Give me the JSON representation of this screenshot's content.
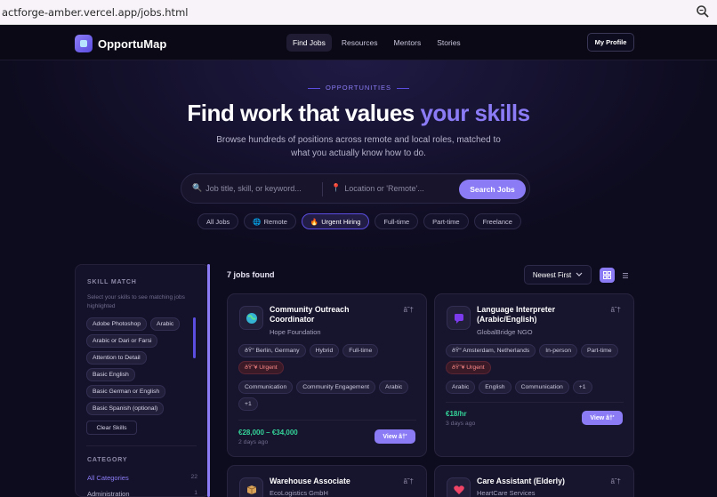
{
  "browser": {
    "url": "actforge-amber.vercel.app/jobs.html"
  },
  "nav": {
    "brand": "OpportuMap",
    "links": [
      "Find Jobs",
      "Resources",
      "Mentors",
      "Stories"
    ],
    "profile": "My Profile"
  },
  "hero": {
    "eyebrow": "OPPORTUNITIES",
    "title_main": "Find work that values ",
    "title_accent": "your skills",
    "subtitle": "Browse hundreds of positions across remote and local roles, matched to what you actually know how to do.",
    "search_icon": "🔍",
    "search_placeholder": "Job title, skill, or keyword...",
    "location_icon": "📍",
    "location_placeholder": "Location or 'Remote'...",
    "search_button": "Search Jobs"
  },
  "filters": [
    {
      "icon": "",
      "label": "All Jobs"
    },
    {
      "icon": "🌐",
      "label": "Remote"
    },
    {
      "icon": "🔥",
      "label": "Urgent Hiring"
    },
    {
      "icon": "",
      "label": "Full-time"
    },
    {
      "icon": "",
      "label": "Part-time"
    },
    {
      "icon": "",
      "label": "Freelance"
    }
  ],
  "sidebar": {
    "skill_heading": "SKILL MATCH",
    "skill_hint": "Select your skills to see matching jobs highlighted",
    "skills": [
      "Adobe Photoshop",
      "Arabic",
      "Arabic or Dari or Farsi",
      "Attention to Detail",
      "Basic English",
      "Basic German or English",
      "Basic Spanish (optional)"
    ],
    "clear_button": "Clear Skills",
    "category_heading": "CATEGORY",
    "categories": [
      {
        "name": "All Categories",
        "count": "22"
      },
      {
        "name": "Administration",
        "count": "1"
      }
    ]
  },
  "results": {
    "count": "7 jobs found",
    "sort": "Newest First"
  },
  "jobs": [
    {
      "title": "Community Outreach Coordinator",
      "company": "Hope Foundation",
      "save": "â˜†",
      "tags_meta": [
        "ðŸ“ Berlin, Germany",
        "Hybrid",
        "Full-time",
        "ðŸ”¥ Urgent"
      ],
      "tags_skills": [
        "Communication",
        "Community Engagement",
        "Arabic",
        "+1"
      ],
      "salary": "€28,000 – €34,000",
      "posted": "2 days ago",
      "view": "View â†'"
    },
    {
      "title": "Language Interpreter (Arabic/English)",
      "company": "GlobalBridge NGO",
      "save": "â˜†",
      "tags_meta": [
        "ðŸ“ Amsterdam, Netherlands",
        "In-person",
        "Part-time",
        "ðŸ”¥ Urgent"
      ],
      "tags_skills": [
        "Arabic",
        "English",
        "Communication",
        "+1"
      ],
      "salary": "€18/hr",
      "posted": "3 days ago",
      "view": "View â†'"
    },
    {
      "title": "Warehouse Associate",
      "company": "EcoLogistics GmbH",
      "save": "â˜†"
    },
    {
      "title": "Care Assistant (Elderly)",
      "company": "HeartCare Services",
      "save": "â˜†"
    }
  ],
  "colors": {
    "accent": "#8b7cf6",
    "salary": "#34d399",
    "urgent": "#ff8a8a",
    "background": "#0d0b1e"
  }
}
